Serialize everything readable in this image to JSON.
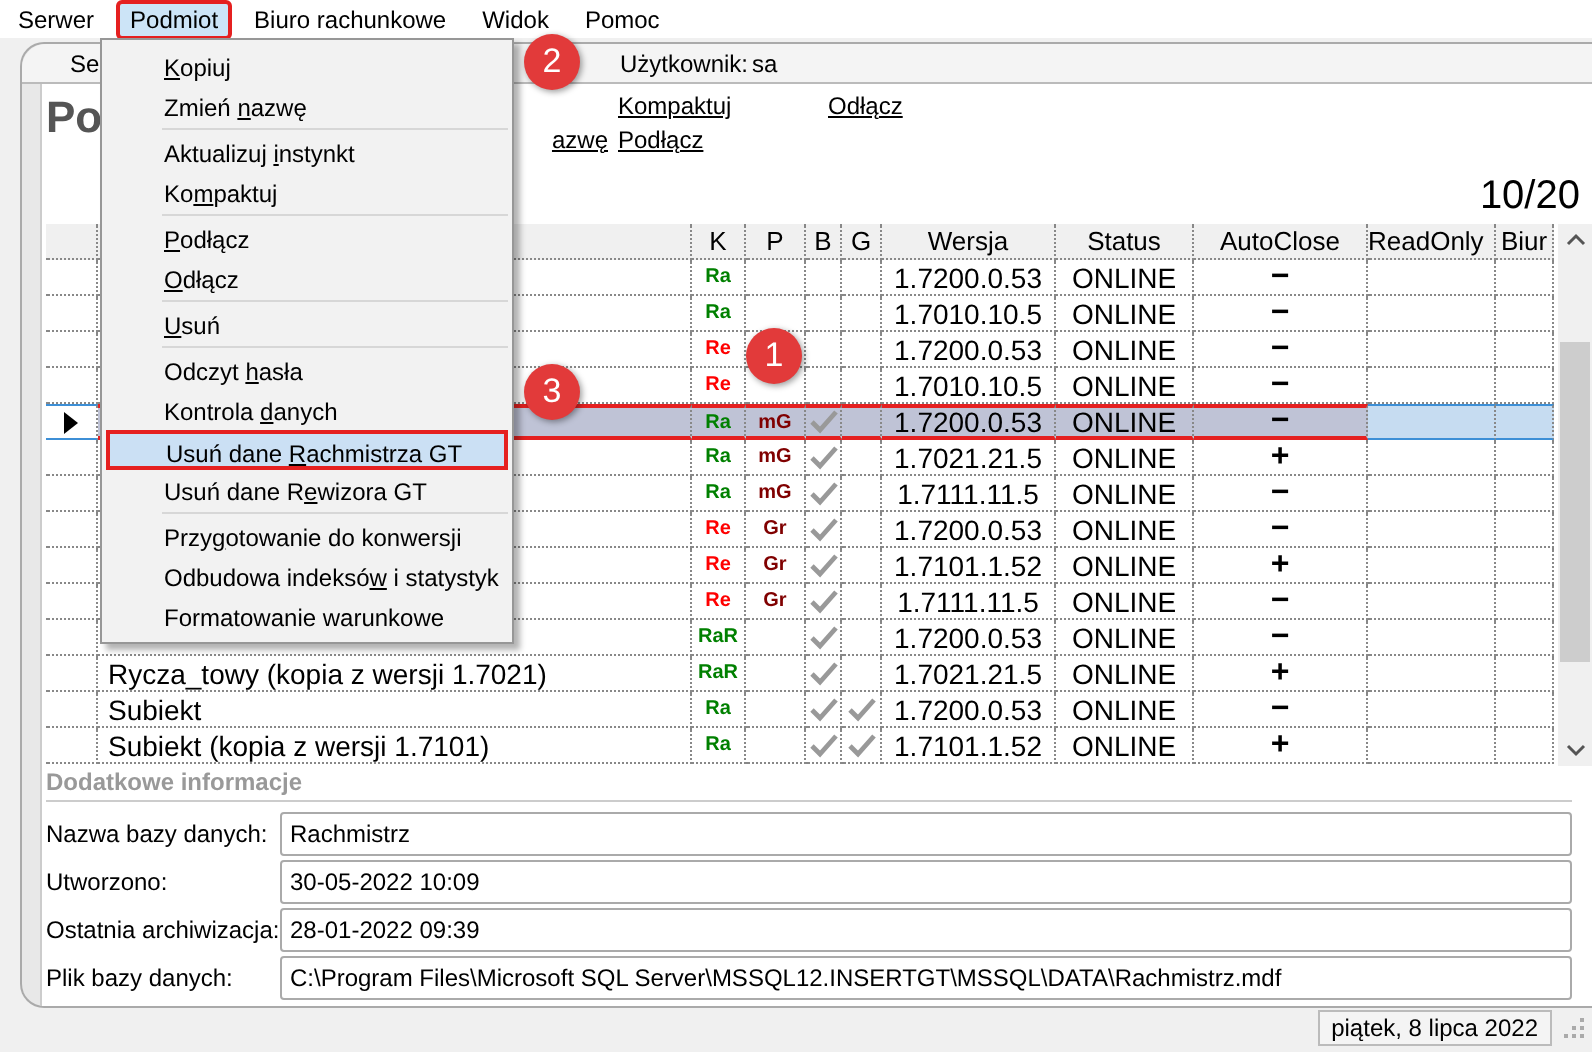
{
  "menu_bar": [
    {
      "label": "Serwer",
      "selected": false
    },
    {
      "label": "Podmiot",
      "selected": true
    },
    {
      "label": "Biuro rachunkowe",
      "selected": false
    },
    {
      "label": "Widok",
      "selected": false
    },
    {
      "label": "Pomoc",
      "selected": false
    }
  ],
  "dropdown": [
    {
      "kind": "item",
      "key": "K",
      "post": "opiuj",
      "selected": false
    },
    {
      "kind": "item",
      "pre": "Zmień ",
      "key": "n",
      "post": "azwę",
      "selected": false
    },
    {
      "kind": "separator"
    },
    {
      "kind": "item",
      "pre": "Aktualizuj ",
      "key": "i",
      "post": "nstynkt",
      "selected": false
    },
    {
      "kind": "item",
      "pre": "Ko",
      "key": "m",
      "post": "paktuj",
      "selected": false
    },
    {
      "kind": "separator"
    },
    {
      "kind": "item",
      "key": "P",
      "post": "odłącz",
      "selected": false
    },
    {
      "kind": "item",
      "key": "O",
      "post": "dłącz",
      "selected": false
    },
    {
      "kind": "separator"
    },
    {
      "kind": "item",
      "key": "U",
      "post": "suń",
      "selected": false
    },
    {
      "kind": "separator"
    },
    {
      "kind": "item",
      "pre": "Odczyt ",
      "key": "h",
      "post": "asła",
      "selected": false
    },
    {
      "kind": "item",
      "pre": "Kontrola ",
      "key": "d",
      "post": "anych",
      "selected": false
    },
    {
      "kind": "item",
      "pre": "Usuń dane ",
      "key": "R",
      "post": "achmistrza GT",
      "selected": true
    },
    {
      "kind": "item",
      "pre": "Usuń dane R",
      "key": "e",
      "post": "wizora GT",
      "selected": false
    },
    {
      "kind": "separator"
    },
    {
      "kind": "item",
      "pre": "Przy",
      "key": "g",
      "post": "otowanie do konwersji",
      "selected": false
    },
    {
      "kind": "item",
      "pre": "Odbudowa indeksó",
      "key": "w",
      "post": " i statystyk",
      "selected": false
    },
    {
      "kind": "item",
      "pre": "Formatowanie warunkowe",
      "selected": false
    }
  ],
  "panel": {
    "tab": "Se",
    "user_label": "Użytkownik:",
    "user": "sa",
    "title": "Po",
    "links": [
      "Kompaktuj",
      "Odłącz",
      "azwę",
      "Podłącz"
    ],
    "count": "10/20"
  },
  "table": {
    "columns": [
      "K",
      "P",
      "B",
      "G",
      "Wersja",
      "Status",
      "AutoClose",
      "ReadOnly",
      "Biur"
    ],
    "rows": [
      {
        "k": {
          "text": "Ra",
          "color": "#008000"
        },
        "b": false,
        "g": false,
        "version": "1.7200.0.53",
        "status": "ONLINE",
        "autoclose": "−",
        "selected": false
      },
      {
        "k": {
          "text": "Ra",
          "color": "#008000"
        },
        "b": false,
        "g": false,
        "version": "1.7010.10.5",
        "status": "ONLINE",
        "autoclose": "−",
        "selected": false
      },
      {
        "k": {
          "text": "Re",
          "color": "#ff0000"
        },
        "b": false,
        "g": false,
        "version": "1.7200.0.53",
        "status": "ONLINE",
        "autoclose": "−",
        "selected": false
      },
      {
        "k": {
          "text": "Re",
          "color": "#ff0000"
        },
        "b": false,
        "g": false,
        "version": "1.7010.10.5",
        "status": "ONLINE",
        "autoclose": "−",
        "selected": false
      },
      {
        "k": {
          "text": "Ra",
          "color": "#008000"
        },
        "p": {
          "text": "mG",
          "color": "#800000"
        },
        "b": true,
        "g": false,
        "version": "1.7200.0.53",
        "status": "ONLINE",
        "autoclose": "−",
        "selected": true
      },
      {
        "k": {
          "text": "Ra",
          "color": "#008000"
        },
        "p": {
          "text": "mG",
          "color": "#800000"
        },
        "b": true,
        "g": false,
        "version": "1.7021.21.5",
        "status": "ONLINE",
        "autoclose": "+",
        "selected": false
      },
      {
        "k": {
          "text": "Ra",
          "color": "#008000"
        },
        "p": {
          "text": "mG",
          "color": "#800000"
        },
        "b": true,
        "g": false,
        "version": "1.7111.11.5",
        "status": "ONLINE",
        "autoclose": "−",
        "selected": false
      },
      {
        "k": {
          "text": "Re",
          "color": "#ff0000"
        },
        "p": {
          "text": "Gr",
          "color": "#800000"
        },
        "b": true,
        "g": false,
        "version": "1.7200.0.53",
        "status": "ONLINE",
        "autoclose": "−",
        "selected": false
      },
      {
        "k": {
          "text": "Re",
          "color": "#ff0000"
        },
        "p": {
          "text": "Gr",
          "color": "#800000"
        },
        "b": true,
        "g": false,
        "version": "1.7101.1.52",
        "status": "ONLINE",
        "autoclose": "+",
        "selected": false
      },
      {
        "k": {
          "text": "Re",
          "color": "#ff0000"
        },
        "p": {
          "text": "Gr",
          "color": "#800000"
        },
        "b": true,
        "g": false,
        "version": "1.7111.11.5",
        "status": "ONLINE",
        "autoclose": "−",
        "selected": false
      },
      {
        "k": {
          "text": "RaR",
          "color": "#008000"
        },
        "b": true,
        "g": false,
        "version": "1.7200.0.53",
        "status": "ONLINE",
        "autoclose": "−",
        "selected": false
      },
      {
        "name": "Rycza_towy (kopia z wersji 1.7021)",
        "k": {
          "text": "RaR",
          "color": "#008000"
        },
        "b": true,
        "g": false,
        "version": "1.7021.21.5",
        "status": "ONLINE",
        "autoclose": "+",
        "selected": false
      },
      {
        "name": "Subiekt",
        "k": {
          "text": "Ra",
          "color": "#008000"
        },
        "b": true,
        "g": true,
        "version": "1.7200.0.53",
        "status": "ONLINE",
        "autoclose": "−",
        "selected": false
      },
      {
        "name": "Subiekt (kopia z wersji 1.7101)",
        "k": {
          "text": "Ra",
          "color": "#008000"
        },
        "b": true,
        "g": true,
        "version": "1.7101.1.52",
        "status": "ONLINE",
        "autoclose": "+",
        "selected": false
      }
    ]
  },
  "details": {
    "title": "Dodatkowe informacje",
    "fields": [
      {
        "label": "Nazwa bazy danych:",
        "value": "Rachmistrz"
      },
      {
        "label": "Utworzono:",
        "value": "30-05-2022 10:09"
      },
      {
        "label": "Ostatnia archiwizacja:",
        "value": "28-01-2022 09:39"
      },
      {
        "label": "Plik bazy danych:",
        "value": "C:\\Program Files\\Microsoft SQL Server\\MSSQL12.INSERTGT\\MSSQL\\DATA\\Rachmistrz.mdf"
      }
    ]
  },
  "status_bar": {
    "date": "piątek, 8 lipca 2022"
  },
  "annotations": [
    "1",
    "2",
    "3"
  ]
}
